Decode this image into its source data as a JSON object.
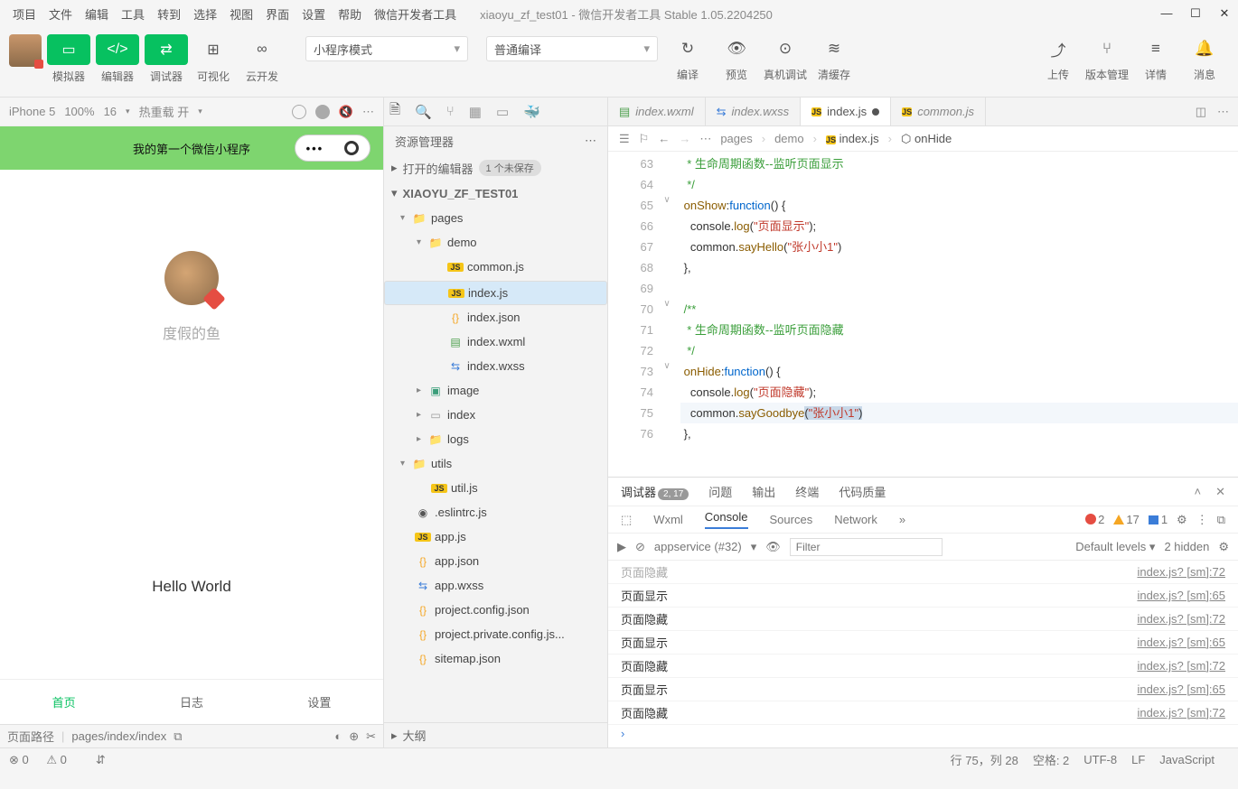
{
  "menubar": [
    "项目",
    "文件",
    "编辑",
    "工具",
    "转到",
    "选择",
    "视图",
    "界面",
    "设置",
    "帮助",
    "微信开发者工具"
  ],
  "window_title": "xiaoyu_zf_test01 - 微信开发者工具 Stable 1.05.2204250",
  "toolbar": {
    "group1_labels": [
      "模拟器",
      "编辑器",
      "调试器"
    ],
    "group2_labels": [
      "可视化",
      "云开发"
    ],
    "mode": "小程序模式",
    "compile": "普通编译",
    "actions": [
      {
        "label": "编译"
      },
      {
        "label": "预览"
      },
      {
        "label": "真机调试"
      },
      {
        "label": "清缓存"
      }
    ],
    "right_actions": [
      {
        "label": "上传"
      },
      {
        "label": "版本管理"
      },
      {
        "label": "详情"
      },
      {
        "label": "消息"
      }
    ]
  },
  "simulator": {
    "device": "iPhone 5",
    "zoom": "100%",
    "font": "16",
    "reload": "热重载 开",
    "app_title": "我的第一个微信小程序",
    "nickname": "度假的鱼",
    "hello": "Hello World",
    "tabs": [
      "首页",
      "日志",
      "设置"
    ],
    "footer_label": "页面路径",
    "footer_path": "pages/index/index"
  },
  "explorer": {
    "title": "资源管理器",
    "opened": "打开的编辑器",
    "opened_badge": "1 个未保存",
    "project": "XIAOYU_ZF_TEST01",
    "tree": [
      {
        "pad": 18,
        "arrow": "▾",
        "cls": "folder",
        "ic": "📁",
        "label": "pages"
      },
      {
        "pad": 36,
        "arrow": "▾",
        "cls": "folder",
        "ic": "📁",
        "label": "demo"
      },
      {
        "pad": 58,
        "arrow": "",
        "cls": "js",
        "ic": "JS",
        "label": "common.js"
      },
      {
        "pad": 58,
        "arrow": "",
        "cls": "js",
        "ic": "JS",
        "label": "index.js",
        "sel": true
      },
      {
        "pad": 58,
        "arrow": "",
        "cls": "json",
        "ic": "{}",
        "label": "index.json"
      },
      {
        "pad": 58,
        "arrow": "",
        "cls": "wxml",
        "ic": "▤",
        "label": "index.wxml"
      },
      {
        "pad": 58,
        "arrow": "",
        "cls": "wxss",
        "ic": "⇆",
        "label": "index.wxss"
      },
      {
        "pad": 36,
        "arrow": "▸",
        "cls": "img",
        "ic": "▣",
        "label": "image"
      },
      {
        "pad": 36,
        "arrow": "▸",
        "cls": "idx",
        "ic": "▭",
        "label": "index"
      },
      {
        "pad": 36,
        "arrow": "▸",
        "cls": "folder",
        "ic": "📁",
        "label": "logs"
      },
      {
        "pad": 18,
        "arrow": "▾",
        "cls": "folder",
        "ic": "📁",
        "label": "utils"
      },
      {
        "pad": 40,
        "arrow": "",
        "cls": "js",
        "ic": "JS",
        "label": "util.js"
      },
      {
        "pad": 22,
        "arrow": "",
        "cls": "lint",
        "ic": "◉",
        "label": ".eslintrc.js"
      },
      {
        "pad": 22,
        "arrow": "",
        "cls": "js",
        "ic": "JS",
        "label": "app.js"
      },
      {
        "pad": 22,
        "arrow": "",
        "cls": "json",
        "ic": "{}",
        "label": "app.json"
      },
      {
        "pad": 22,
        "arrow": "",
        "cls": "wxss",
        "ic": "⇆",
        "label": "app.wxss"
      },
      {
        "pad": 22,
        "arrow": "",
        "cls": "json",
        "ic": "{}",
        "label": "project.config.json"
      },
      {
        "pad": 22,
        "arrow": "",
        "cls": "json",
        "ic": "{}",
        "label": "project.private.config.js..."
      },
      {
        "pad": 22,
        "arrow": "",
        "cls": "json",
        "ic": "{}",
        "label": "sitemap.json"
      }
    ],
    "outline": "大纲"
  },
  "editor": {
    "tabs": [
      {
        "cls": "wxml",
        "ic": "▤",
        "label": "index.wxml"
      },
      {
        "cls": "wxss",
        "ic": "⇆",
        "label": "index.wxss"
      },
      {
        "cls": "js",
        "ic": "JS",
        "label": "index.js",
        "active": true,
        "dirty": true
      },
      {
        "cls": "js",
        "ic": "JS",
        "label": "common.js"
      }
    ],
    "crumb": [
      "pages",
      "demo",
      "index.js",
      "onHide"
    ],
    "lines": [
      {
        "n": 63,
        "html": "  <span class='c-cm'>* 生命周期函数--监听页面显示</span>"
      },
      {
        "n": 64,
        "html": "  <span class='c-cm'>*/</span>"
      },
      {
        "n": 65,
        "fold": "∨",
        "html": " <span class='c-fn'>onShow</span><span class='c-p'>:</span><span class='c-kw'>function</span><span class='c-p'>() {</span>"
      },
      {
        "n": 66,
        "html": "   <span class='c-p'>console.</span><span class='c-fn'>log</span><span class='c-p'>(</span><span class='c-str'>\"页面显示\"</span><span class='c-p'>);</span>"
      },
      {
        "n": 67,
        "html": "   <span class='c-p'>common.</span><span class='c-fn'>sayHello</span><span class='c-p'>(</span><span class='c-str'>\"张小小1\"</span><span class='c-p'>)</span>"
      },
      {
        "n": 68,
        "html": " <span class='c-p'>},</span>"
      },
      {
        "n": 69,
        "html": ""
      },
      {
        "n": 70,
        "fold": "∨",
        "html": " <span class='c-cm'>/**</span>"
      },
      {
        "n": 71,
        "html": "  <span class='c-cm'>* 生命周期函数--监听页面隐藏</span>"
      },
      {
        "n": 72,
        "html": "  <span class='c-cm'>*/</span>"
      },
      {
        "n": 73,
        "fold": "∨",
        "html": " <span class='c-fn'>onHide</span><span class='c-p'>:</span><span class='c-kw'>function</span><span class='c-p'>() {</span>"
      },
      {
        "n": 74,
        "html": "   <span class='c-p'>console.</span><span class='c-fn'>log</span><span class='c-p'>(</span><span class='c-str'>\"页面隐藏\"</span><span class='c-p'>);</span>"
      },
      {
        "n": 75,
        "cursor": true,
        "html": "   <span class='c-p'>common.</span><span class='c-fn'>sayGoodbye</span><span class='hl'><span class='c-p'>(</span><span class='c-str'>\"张小小1\"</span><span class='c-p'>)</span></span>"
      },
      {
        "n": 76,
        "html": " <span class='c-p'>},</span>"
      }
    ]
  },
  "panel": {
    "tabs": [
      "调试器",
      "问题",
      "输出",
      "终端",
      "代码质量"
    ],
    "badge": "2, 17",
    "devtabs": [
      "Wxml",
      "Console",
      "Sources",
      "Network"
    ],
    "counts": {
      "err": "2",
      "warn": "17",
      "msg": "1"
    },
    "context": "appservice (#32)",
    "filter_ph": "Filter",
    "levels": "Default levels",
    "hidden": "2 hidden",
    "logs": [
      {
        "msg": "页面隐藏",
        "src": "index.js? [sm]:72",
        "dim": true
      },
      {
        "msg": "页面显示",
        "src": "index.js? [sm]:65"
      },
      {
        "msg": "页面隐藏",
        "src": "index.js? [sm]:72"
      },
      {
        "msg": "页面显示",
        "src": "index.js? [sm]:65"
      },
      {
        "msg": "页面隐藏",
        "src": "index.js? [sm]:72"
      },
      {
        "msg": "页面显示",
        "src": "index.js? [sm]:65"
      },
      {
        "msg": "页面隐藏",
        "src": "index.js? [sm]:72"
      }
    ]
  },
  "status": {
    "pos": "行 75，列 28",
    "spaces": "空格: 2",
    "enc": "UTF-8",
    "eol": "LF",
    "lang": "JavaScript",
    "err": "0",
    "warn": "0"
  }
}
